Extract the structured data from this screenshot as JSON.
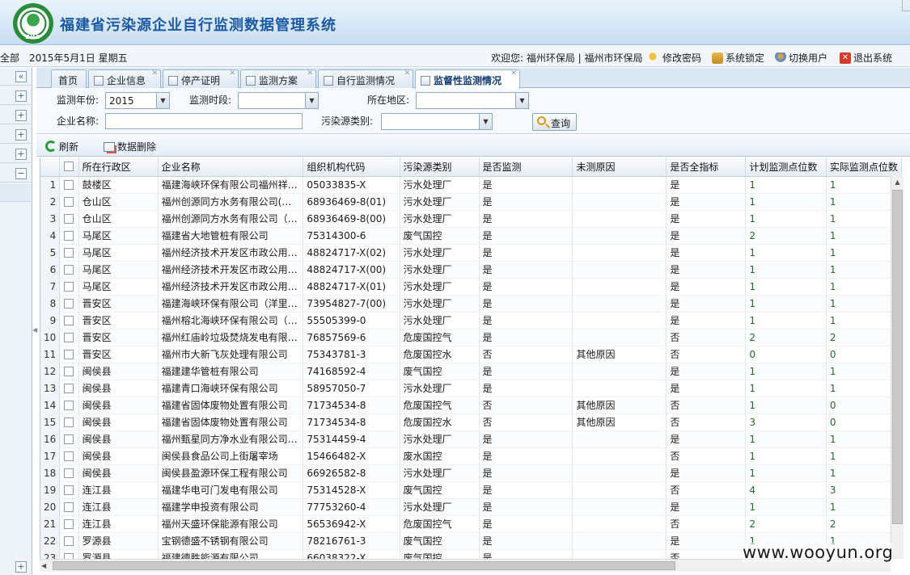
{
  "app": {
    "title": "福建省污染源企业自行监测数据管理系统",
    "logo_text": "ZHB"
  },
  "infobar": {
    "scope": "全部",
    "date": "2015年5月1日 星期五",
    "welcome": "欢迎您: 福州环保局 | 福州市环保局",
    "change_password": "修改密码",
    "lock_system": "系统锁定",
    "switch_user": "切换用户",
    "logout": "退出系统"
  },
  "tabs": [
    {
      "label": "首页"
    },
    {
      "label": "企业信息"
    },
    {
      "label": "停产证明"
    },
    {
      "label": "监测方案"
    },
    {
      "label": "自行监测情况"
    },
    {
      "label": "监督性监测情况"
    }
  ],
  "active_tab": "监督性监测情况",
  "filters": {
    "year_label": "监测年份:",
    "year_value": "2015",
    "period_label": "监测时段:",
    "period_value": "",
    "region_label": "所在地区:",
    "region_value": "",
    "company_label": "企业名称:",
    "company_value": "",
    "source_type_label": "污染源类别:",
    "source_type_value": "",
    "query_button": "查询"
  },
  "toolbar": {
    "refresh": "刷新",
    "delete": "数据删除"
  },
  "grid": {
    "columns": [
      "所在行政区",
      "企业名称",
      "组织机构代码",
      "污染源类别",
      "是否监测",
      "未测原因",
      "是否全指标",
      "计划监测点位数",
      "实际监测点位数"
    ],
    "rows": [
      [
        "1",
        "鼓楼区",
        "福建海峡环保有限公司福州祥…",
        "05033835-X",
        "污水处理厂",
        "是",
        "",
        "是",
        "1",
        "1"
      ],
      [
        "2",
        "仓山区",
        "福州创源同方水务有限公司(…",
        "68936469-8(01)",
        "污水处理厂",
        "是",
        "",
        "是",
        "1",
        "1"
      ],
      [
        "3",
        "仓山区",
        "福州创源同方水务有限公司（…",
        "68936469-8(00)",
        "污水处理厂",
        "是",
        "",
        "是",
        "1",
        "1"
      ],
      [
        "4",
        "马尾区",
        "福建省大地管桩有限公司",
        "75314300-6",
        "废气国控",
        "是",
        "",
        "是",
        "2",
        "1"
      ],
      [
        "5",
        "马尾区",
        "福州经济技术开发区市政公用…",
        "48824717-X(02)",
        "污水处理厂",
        "是",
        "",
        "是",
        "1",
        "1"
      ],
      [
        "6",
        "马尾区",
        "福州经济技术开发区市政公用…",
        "48824717-X(00)",
        "污水处理厂",
        "是",
        "",
        "是",
        "1",
        "1"
      ],
      [
        "7",
        "马尾区",
        "福州经济技术开发区市政公用…",
        "48824717-X(01)",
        "污水处理厂",
        "是",
        "",
        "是",
        "1",
        "1"
      ],
      [
        "8",
        "晋安区",
        "福建海峡环保有限公司（洋里…",
        "73954827-7(00)",
        "污水处理厂",
        "是",
        "",
        "是",
        "1",
        "1"
      ],
      [
        "9",
        "晋安区",
        "福州榕北海峡环保有限公司（…",
        "55505399-0",
        "污水处理厂",
        "是",
        "",
        "是",
        "1",
        "1"
      ],
      [
        "10",
        "晋安区",
        "福州红庙岭垃圾焚烧发电有限…",
        "76857569-6",
        "危废国控气",
        "是",
        "",
        "否",
        "2",
        "2"
      ],
      [
        "11",
        "晋安区",
        "福州市大新飞灰处理有限公司",
        "75343781-3",
        "危废国控水",
        "否",
        "其他原因",
        "否",
        "0",
        "0"
      ],
      [
        "12",
        "闽侯县",
        "福建建华管桩有限公司",
        "74168592-4",
        "废气国控",
        "是",
        "",
        "是",
        "1",
        "1"
      ],
      [
        "13",
        "闽侯县",
        "福建青口海峡环保有限公司",
        "58957050-7",
        "污水处理厂",
        "是",
        "",
        "是",
        "1",
        "1"
      ],
      [
        "14",
        "闽侯县",
        "福建省固体废物处置有限公司",
        "71734534-8",
        "危废国控气",
        "否",
        "其他原因",
        "否",
        "1",
        "0"
      ],
      [
        "15",
        "闽侯县",
        "福建省固体废物处置有限公司",
        "71734534-8",
        "危废国控水",
        "否",
        "其他原因",
        "否",
        "3",
        "0"
      ],
      [
        "16",
        "闽侯县",
        "福州甄星同方净水业有限公司…",
        "75314459-4",
        "污水处理厂",
        "是",
        "",
        "是",
        "1",
        "1"
      ],
      [
        "17",
        "闽侯县",
        "闽侯县食品公司上街屠宰场",
        "15466482-X",
        "废水国控",
        "是",
        "",
        "否",
        "1",
        "1"
      ],
      [
        "18",
        "闽侯县",
        "闽侯县盈源环保工程有限公司",
        "66926582-8",
        "污水处理厂",
        "是",
        "",
        "是",
        "1",
        "1"
      ],
      [
        "19",
        "连江县",
        "福建华电可门发电有限公司",
        "75314528-X",
        "废气国控",
        "是",
        "",
        "否",
        "4",
        "3"
      ],
      [
        "20",
        "连江县",
        "福建学申投资有限公司",
        "77753260-4",
        "污水处理厂",
        "是",
        "",
        "是",
        "1",
        "1"
      ],
      [
        "21",
        "连江县",
        "福州天盛环保能源有限公司",
        "56536942-X",
        "危废国控气",
        "是",
        "",
        "否",
        "2",
        "2"
      ],
      [
        "22",
        "罗源县",
        "宝钢德盛不锈钢有限公司",
        "78216761-3",
        "废气国控",
        "是",
        "",
        "是",
        "1",
        "1"
      ],
      [
        "23",
        "罗源县",
        "福建德胜能源有限公司",
        "66038322-X",
        "废气国控",
        "是",
        "",
        "否",
        "",
        ""
      ]
    ]
  },
  "watermark": "www.wooyun.org",
  "colors": {
    "header_title": "#1d5aa3",
    "tab_active": "#153e75",
    "query_icon": "#d99a1c",
    "refresh_icon": "#2e9a3e"
  }
}
